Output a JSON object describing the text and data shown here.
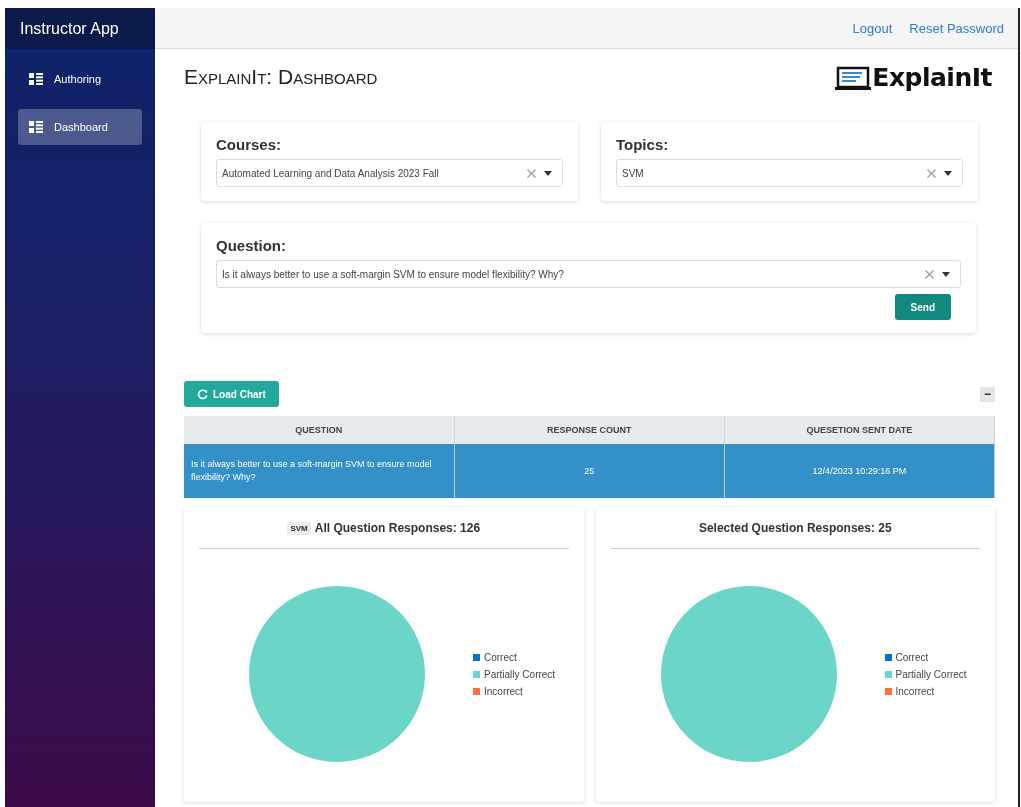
{
  "sidebar": {
    "title": "Instructor App",
    "items": [
      {
        "label": "Authoring",
        "selected": false
      },
      {
        "label": "Dashboard",
        "selected": true
      }
    ]
  },
  "top_bar": {
    "links": [
      "Logout",
      "Reset Password"
    ]
  },
  "page_title": "ExplainIt: Dashboard",
  "logo": {
    "text": "ExplainIt"
  },
  "filters": {
    "courses": {
      "label": "Courses:",
      "value": "Automated Learning and Data Analysis 2023 Fall"
    },
    "topics": {
      "label": "Topics:",
      "value": "SVM"
    },
    "question": {
      "label": "Question:",
      "value": "Is it always better to use a soft-margin SVM to ensure model flexibility? Why?"
    },
    "send_button": "Send"
  },
  "load_chart_button": "Load Chart",
  "collapse_button": "−",
  "table": {
    "columns": [
      "QUESTION",
      "RESPONSE COUNT",
      "QUESETION SENT DATE"
    ],
    "rows": [
      {
        "cells": [
          "Is it always better to use a soft-margin SVM to ensure model flexibility? Why?",
          "25",
          "12/4/2023 10:29:16 PM"
        ],
        "selected": true
      }
    ]
  },
  "charts": [
    {
      "tag": "SVM",
      "title": "All Question Responses: 126",
      "chart_data": {
        "type": "pie",
        "categories": [
          "Correct",
          "Partially Correct",
          "Incorrect"
        ],
        "values": [
          0,
          100,
          0
        ],
        "colors": [
          "#0b6fcf",
          "#6bd5c8",
          "#ff6f3f"
        ]
      }
    },
    {
      "title": "Selected Question Responses: 25",
      "chart_data": {
        "type": "pie",
        "categories": [
          "Correct",
          "Partially Correct",
          "Incorrect"
        ],
        "values": [
          0,
          100,
          0
        ],
        "colors": [
          "#0b6fcf",
          "#6bd5c8",
          "#ff6f3f"
        ]
      }
    }
  ]
}
